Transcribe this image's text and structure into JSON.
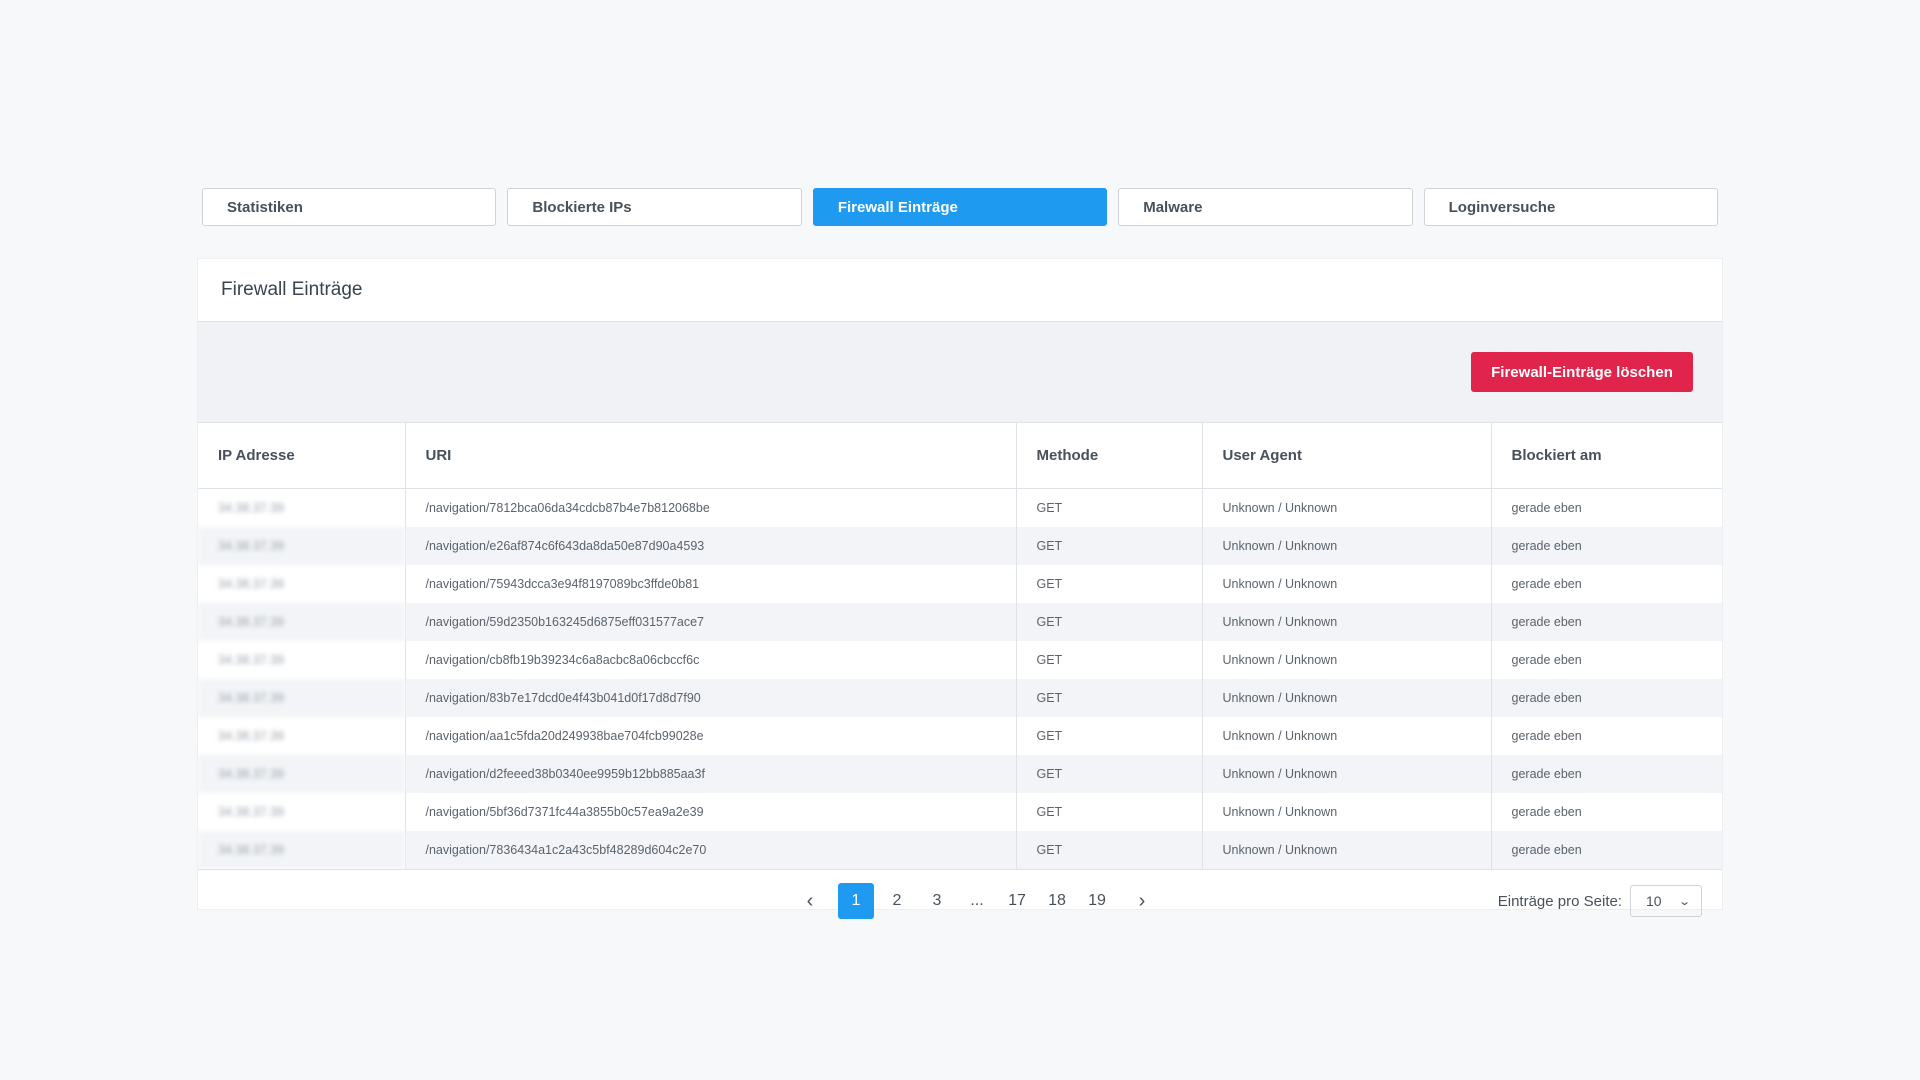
{
  "tabs": [
    {
      "label": "Statistiken",
      "active": false
    },
    {
      "label": "Blockierte IPs",
      "active": false
    },
    {
      "label": "Firewall Einträge",
      "active": true
    },
    {
      "label": "Malware",
      "active": false
    },
    {
      "label": "Loginversuche",
      "active": false
    }
  ],
  "card": {
    "title": "Firewall Einträge",
    "delete_button": "Firewall-Einträge löschen"
  },
  "colors": {
    "accent": "#1e9bf0",
    "danger": "#e0244b"
  },
  "table": {
    "headers": [
      "IP Adresse",
      "URI",
      "Methode",
      "User Agent",
      "Blockiert am"
    ],
    "rows": [
      [
        "34.38.37.39",
        "/navigation/7812bca06da34cdcb87b4e7b812068be",
        "GET",
        "Unknown / Unknown",
        "gerade eben"
      ],
      [
        "34.38.37.39",
        "/navigation/e26af874c6f643da8da50e87d90a4593",
        "GET",
        "Unknown / Unknown",
        "gerade eben"
      ],
      [
        "34.38.37.39",
        "/navigation/75943dcca3e94f8197089bc3ffde0b81",
        "GET",
        "Unknown / Unknown",
        "gerade eben"
      ],
      [
        "34.38.37.39",
        "/navigation/59d2350b163245d6875eff031577ace7",
        "GET",
        "Unknown / Unknown",
        "gerade eben"
      ],
      [
        "34.38.37.39",
        "/navigation/cb8fb19b39234c6a8acbc8a06cbccf6c",
        "GET",
        "Unknown / Unknown",
        "gerade eben"
      ],
      [
        "34.38.37.39",
        "/navigation/83b7e17dcd0e4f43b041d0f17d8d7f90",
        "GET",
        "Unknown / Unknown",
        "gerade eben"
      ],
      [
        "34.38.37.39",
        "/navigation/aa1c5fda20d249938bae704fcb99028e",
        "GET",
        "Unknown / Unknown",
        "gerade eben"
      ],
      [
        "34.38.37.39",
        "/navigation/d2feeed38b0340ee9959b12bb885aa3f",
        "GET",
        "Unknown / Unknown",
        "gerade eben"
      ],
      [
        "34.38.37.39",
        "/navigation/5bf36d7371fc44a3855b0c57ea9a2e39",
        "GET",
        "Unknown / Unknown",
        "gerade eben"
      ],
      [
        "34.38.37.39",
        "/navigation/7836434a1c2a43c5bf48289d604c2e70",
        "GET",
        "Unknown / Unknown",
        "gerade eben"
      ]
    ]
  },
  "pagination": {
    "prev_icon": "‹",
    "next_icon": "›",
    "pages": [
      "1",
      "2",
      "3",
      "...",
      "17",
      "18",
      "19"
    ],
    "current": "1",
    "per_page_label": "Einträge pro Seite:",
    "per_page_value": "10"
  }
}
